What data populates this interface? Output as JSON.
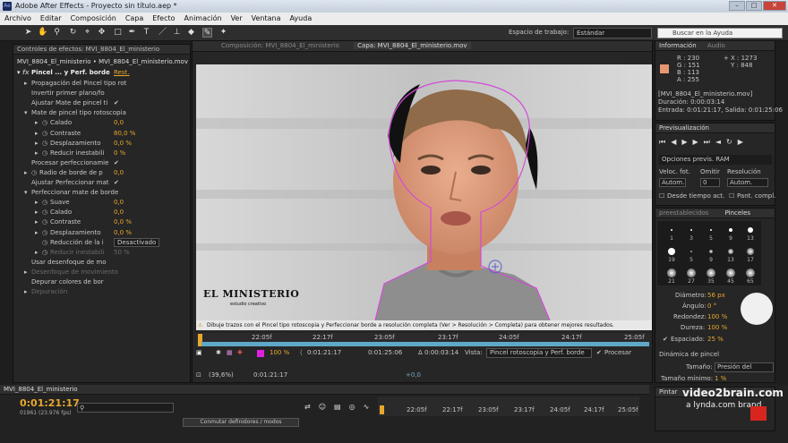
{
  "titlebar": {
    "title": "Adobe After Effects - Proyecto sin título.aep *"
  },
  "menu": [
    "Archivo",
    "Editar",
    "Composición",
    "Capa",
    "Efecto",
    "Animación",
    "Ver",
    "Ventana",
    "Ayuda"
  ],
  "toolbar": {
    "workspace_label": "Espacio de trabajo:",
    "workspace_value": "Estándar",
    "search_placeholder": "Buscar en la Ayuda"
  },
  "effects": {
    "tab": "Controles de efectos: MVI_8804_El_ministerio",
    "header": "MVI_8804_El_ministerio • MVI_8804_El_ministerio.mov",
    "fx_name": "Pincel ... y Perf. borde",
    "fx_reset": "Rest.",
    "props": [
      {
        "label": "Propagación del Pincel tipo rot",
        "value": "",
        "indent": 1,
        "tw": "▸"
      },
      {
        "label": "Invertir primer plano/fo",
        "value": "",
        "indent": 1,
        "tw": ""
      },
      {
        "label": "Ajustar Mate de pincel ti",
        "value": "✔",
        "indent": 1,
        "tw": ""
      },
      {
        "label": "Mate de pincel tipo rotoscopia",
        "value": "",
        "indent": 1,
        "tw": "▾"
      },
      {
        "label": "Calado",
        "value": "0,0",
        "indent": 2,
        "tw": "▸"
      },
      {
        "label": "Contraste",
        "value": "80,0 %",
        "indent": 2,
        "tw": "▸"
      },
      {
        "label": "Desplazamiento",
        "value": "0,0 %",
        "indent": 2,
        "tw": "▸"
      },
      {
        "label": "Reducir inestabili",
        "value": "0 %",
        "indent": 2,
        "tw": "▸"
      },
      {
        "label": "Procesar perfeccionamie",
        "value": "✔",
        "indent": 1,
        "tw": ""
      },
      {
        "label": "Radio de borde de p",
        "value": "0,0",
        "indent": 1,
        "tw": "▸"
      },
      {
        "label": "Ajustar Perfeccionar mat",
        "value": "✔",
        "indent": 1,
        "tw": ""
      },
      {
        "label": "Perfeccionar mate de borde",
        "value": "",
        "indent": 1,
        "tw": "▾"
      },
      {
        "label": "Suave",
        "value": "0,0",
        "indent": 2,
        "tw": "▸"
      },
      {
        "label": "Calado",
        "value": "0,0",
        "indent": 2,
        "tw": "▸"
      },
      {
        "label": "Contraste",
        "value": "0,0 %",
        "indent": 2,
        "tw": "▸"
      },
      {
        "label": "Desplazamiento",
        "value": "0,0 %",
        "indent": 2,
        "tw": "▸"
      },
      {
        "label": "Reducción de la i",
        "value": "Desactivado",
        "indent": 2,
        "tw": ""
      },
      {
        "label": "Reducir inestabili",
        "value": "50 %",
        "indent": 2,
        "tw": "▸",
        "disabled": true
      },
      {
        "label": "Usar desenfoque de mo",
        "value": "",
        "indent": 1,
        "tw": ""
      },
      {
        "label": "Desenfoque de movimiento",
        "value": "",
        "indent": 1,
        "tw": "▸",
        "disabled": true
      },
      {
        "label": "Depurar colores de bor",
        "value": "",
        "indent": 1,
        "tw": ""
      },
      {
        "label": "Depuración",
        "value": "",
        "indent": 1,
        "tw": "▸",
        "disabled": true
      }
    ]
  },
  "viewer": {
    "tab_comp": "Composición: MVI_8804_El_ministerio",
    "tab_layer": "Capa: MVI_8804_El_ministerio.mov",
    "watermark_main": "EL MINISTERIO",
    "watermark_sub": "estudio creativo",
    "warning": "Dibuje trazos con el Pincel tipo rotoscopia y Perfeccionar borde a resolución completa (Ver > Resolución > Completa) para obtener mejores resultados.",
    "ruler": [
      "22:05f",
      "22:17f",
      "23:05f",
      "23:17f",
      "24:05f",
      "24:17f",
      "25:05f"
    ],
    "zoom_pct": "100 %",
    "time_start": "0:01:21:17",
    "time_end": "0:01:25:06",
    "duration": "Δ 0:00:03:14",
    "view_label": "Vista:",
    "view_value": "Pincel rotoscopia y Perf. borde",
    "render_label": "Procesar",
    "footer_zoom": "(39,6%)",
    "footer_time": "0:01:21:17",
    "footer_offset": "+0,0"
  },
  "info": {
    "tab": "Información",
    "tab2": "Audio",
    "r": "R : 230",
    "g": "G : 151",
    "b": "B : 113",
    "a": "A : 255",
    "x": "X : 1273",
    "y": "Y : 848",
    "file": "[MVI_8804_El_ministerio.mov]",
    "duration": "Duración: 0:00:03:14",
    "inout": "Entrada: 0:01:21:17, Salida: 0:01:25:06",
    "swatch": "#e69771"
  },
  "preview": {
    "tab": "Previsualización",
    "ram": "Opciones previs. RAM",
    "fps_label": "Veloc. fot.",
    "skip_label": "Omitir",
    "res_label": "Resolución",
    "fps_value": "Autom.",
    "skip_value": "0",
    "res_value": "Autom.",
    "from_current": "Desde tiempo act.",
    "fullscreen": "Pant. compl."
  },
  "brushes": {
    "tab1": "preestablecidos",
    "tab2": "Pinceles",
    "sizes": [
      "1",
      "3",
      "5",
      "9",
      "13",
      "19",
      "5",
      "9",
      "13",
      "17",
      "21",
      "27",
      "35",
      "45",
      "65"
    ],
    "diameter_label": "Diámetro:",
    "diameter": "56 px",
    "angle_label": "Ángulo:",
    "angle": "0 °",
    "round_label": "Redondez:",
    "round": "100 %",
    "hard_label": "Dureza:",
    "hard": "100 %",
    "spacing_label": "Espaciado:",
    "spacing": "25 %",
    "dynamics": "Dinámica de pincel",
    "size_label": "Tamaño:",
    "size_value": "Presión del",
    "min_label": "Tamaño mínimo:",
    "min_value": "1 %"
  },
  "paint": {
    "tab": "Pintar"
  },
  "timeline": {
    "comp_tab": "MVI_8804_El_ministerio",
    "timecode": "0:01:21:17",
    "frames": "01961 (23.976 fps)",
    "toggle": "Conmutar definidores / modos",
    "ruler": [
      "22:05f",
      "22:17f",
      "23:05f",
      "23:17f",
      "24:05f",
      "24:17f",
      "25:05f"
    ]
  },
  "branding": {
    "line1": "video2brain.com",
    "line2": "a lynda.com brand"
  }
}
